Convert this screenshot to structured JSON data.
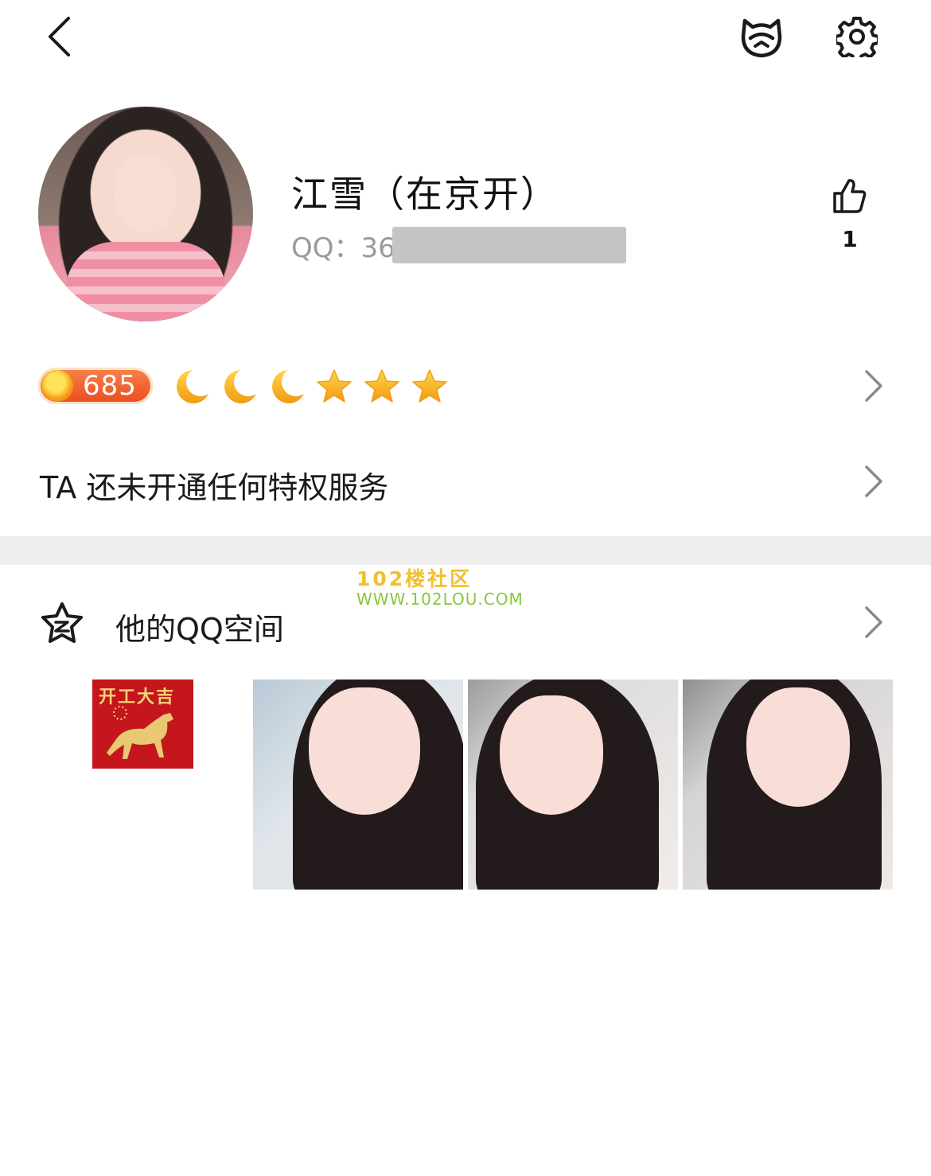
{
  "header": {
    "back_icon": "chevron-left-icon",
    "pet_icon": "cat-face-icon",
    "settings_icon": "gear-icon"
  },
  "profile": {
    "name": "江雪（在京开）",
    "qq_label": "QQ：36",
    "like_count": "1"
  },
  "level": {
    "value": "685",
    "moons": 3,
    "stars": 3,
    "colors": {
      "badge": "#ec4a1f",
      "moon_star": "#f7b21b"
    }
  },
  "privilege": {
    "text": "TA 还未开通任何特权服务"
  },
  "watermark": {
    "line1": "102楼社区",
    "line2": "WWW.102LOU.COM"
  },
  "qzone": {
    "title": "他的QQ空间",
    "thumb_text": "开工大吉"
  },
  "colors": {
    "divider": "#eeeeef",
    "text_secondary": "#9a9a9a",
    "chevron": "#8a8a8a"
  }
}
